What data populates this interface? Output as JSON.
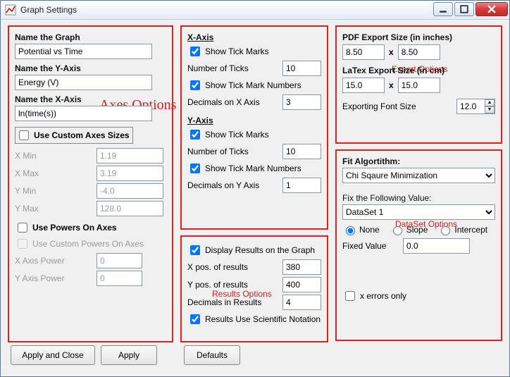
{
  "window": {
    "title": "Graph Settings"
  },
  "annotations": {
    "axes": "Axes Options",
    "results": "Results Options",
    "export": "Export Options",
    "dataset": "DataSet Options"
  },
  "axes": {
    "name_graph_label": "Name the Graph",
    "name_graph_value": "Potential vs Time",
    "name_y_label": "Name the Y-Axis",
    "name_y_value": "Energy (V)",
    "name_x_label": "Name the X-Axis",
    "name_x_value": "ln(time(s))",
    "use_custom_sizes_label": "Use Custom Axes Sizes",
    "xmin_label": "X Min",
    "xmin_value": "1.19",
    "xmax_label": "X Max",
    "xmax_value": "3.19",
    "ymin_label": "Y Min",
    "ymin_value": "-4.0",
    "ymax_label": "Y Max",
    "ymax_value": "128.0",
    "use_powers_label": "Use Powers On Axes",
    "use_custom_powers_label": "Use Custom Powers On Axes",
    "x_power_label": "X Axis Power",
    "x_power_value": "0",
    "y_power_label": "Y Axis Power",
    "y_power_value": "0"
  },
  "xaxis": {
    "header": "X-Axis",
    "show_ticks": "Show Tick Marks",
    "num_ticks_label": "Number of Ticks",
    "num_ticks_value": "10",
    "show_numbers": "Show Tick Mark Numbers",
    "decimals_label": "Decimals on X Axis",
    "decimals_value": "3"
  },
  "yaxis": {
    "header": "Y-Axis",
    "show_ticks": "Show Tick Marks",
    "num_ticks_label": "Number of Ticks",
    "num_ticks_value": "10",
    "show_numbers": "Show Tick Mark Numbers",
    "decimals_label": "Decimals on Y Axis",
    "decimals_value": "1"
  },
  "results": {
    "display_label": "Display Results on the Graph",
    "xpos_label": "X pos. of results",
    "xpos_value": "380",
    "ypos_label": "Y pos. of results",
    "ypos_value": "400",
    "decimals_label": "Decimals in Results",
    "decimals_value": "4",
    "sci_label": "Results Use Scientific Notation"
  },
  "export": {
    "pdf_label": "PDF Export Size (in inches)",
    "pdf_w": "8.50",
    "times": "x",
    "pdf_h": "8.50",
    "latex_label": "LaTex Export Size (in cm)",
    "latex_w": "15.0",
    "latex_h": "15.0",
    "font_label": "Exporting Font Size",
    "font_value": "12.0"
  },
  "dataset": {
    "algo_label": "Fit Algortithm:",
    "algo_value": "Chi Sqaure Minimization",
    "fix_label": "Fix the Following Value:",
    "set_value": "DataSet 1",
    "none": "None",
    "slope": "Slope",
    "intercept": "Intercept",
    "fixed_label": "Fixed Value",
    "fixed_value": "0.0",
    "xerrors_label": "x errors only"
  },
  "buttons": {
    "apply_close": "Apply and Close",
    "apply": "Apply",
    "defaults": "Defaults"
  }
}
